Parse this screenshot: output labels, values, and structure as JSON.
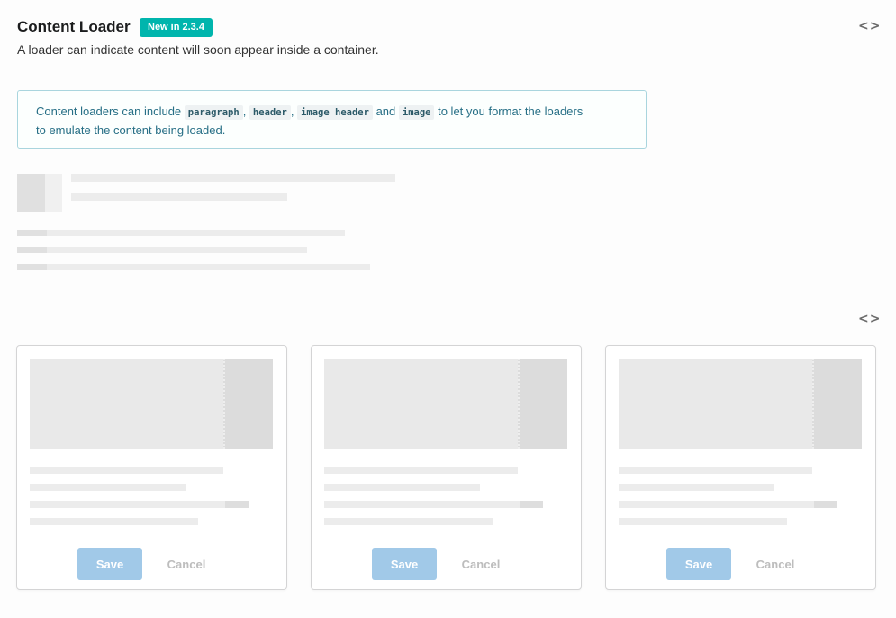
{
  "header": {
    "title": "Content Loader",
    "badge": "New in 2.3.4",
    "subtitle": "A loader can indicate content will soon appear inside a container.",
    "code_toggle": "<>"
  },
  "info": {
    "text_before": "Content loaders can include ",
    "codes": [
      "paragraph",
      "header",
      "image header",
      "image"
    ],
    "sep1": ", ",
    "sep2": ", ",
    "sep3": " and ",
    "text_after": " to let you format the loaders",
    "text_line2": "to emulate the content being loaded."
  },
  "section2": {
    "code_toggle": "<>"
  },
  "cards": [
    {
      "save_label": "Save",
      "cancel_label": "Cancel"
    },
    {
      "save_label": "Save",
      "cancel_label": "Cancel"
    },
    {
      "save_label": "Save",
      "cancel_label": "Cancel"
    }
  ],
  "colors": {
    "badge": "#00b5ad",
    "info_border": "#a9d5de",
    "info_text": "#276f86",
    "save_button": "#a1c9e8",
    "placeholder": "#ececec"
  }
}
